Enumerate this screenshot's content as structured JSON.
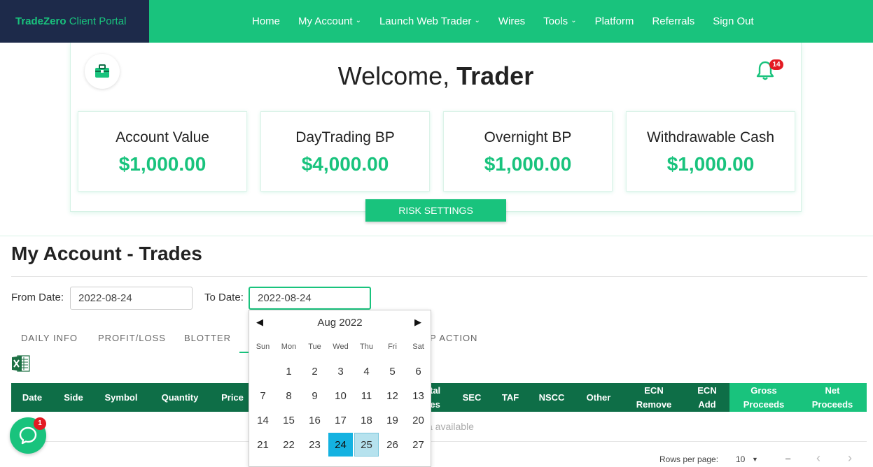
{
  "brand": {
    "bold": "TradeZero",
    "rest": " Client Portal"
  },
  "nav": {
    "items": [
      {
        "label": "Home",
        "dropdown": false
      },
      {
        "label": "My Account",
        "dropdown": true
      },
      {
        "label": "Launch Web Trader",
        "dropdown": true
      },
      {
        "label": "Wires",
        "dropdown": false
      },
      {
        "label": "Tools",
        "dropdown": true
      },
      {
        "label": "Platform",
        "dropdown": false
      },
      {
        "label": "Referrals",
        "dropdown": false
      },
      {
        "label": "Sign Out",
        "dropdown": false
      }
    ]
  },
  "welcome": {
    "prefix": "Welcome, ",
    "name": "Trader"
  },
  "notifications": {
    "count": "14"
  },
  "stats": [
    {
      "label": "Account Value",
      "value": "$1,000.00"
    },
    {
      "label": "DayTrading BP",
      "value": "$4,000.00"
    },
    {
      "label": "Overnight BP",
      "value": "$1,000.00"
    },
    {
      "label": "Withdrawable Cash",
      "value": "$1,000.00"
    }
  ],
  "risk_button": "RISK SETTINGS",
  "page_title": "My Account - Trades",
  "filters": {
    "from_label": "From Date:",
    "from_value": "2022-08-24",
    "to_label": "To Date:",
    "to_value": "2022-08-24"
  },
  "tabs": [
    {
      "label": "DAILY INFO"
    },
    {
      "label": "PROFIT/LOSS"
    },
    {
      "label": "BLOTTER"
    },
    {
      "label": "P ACTION"
    }
  ],
  "table": {
    "columns": [
      {
        "label": "Date"
      },
      {
        "label": "Side"
      },
      {
        "label": "Symbol"
      },
      {
        "label": "Quantity"
      },
      {
        "label": "Price"
      },
      {
        "label": "tal\nes"
      },
      {
        "label": "SEC"
      },
      {
        "label": "TAF"
      },
      {
        "label": "NSCC"
      },
      {
        "label": "Other"
      },
      {
        "label": "ECN\nRemove"
      },
      {
        "label": "ECN\nAdd"
      },
      {
        "label": "Gross\nProceeds"
      },
      {
        "label": "Net\nProceeds"
      }
    ],
    "empty_text": "a available"
  },
  "pagination": {
    "rows_label": "Rows per page:",
    "rows_value": "10",
    "range": "–",
    "prev": "‹",
    "next": "›"
  },
  "calendar": {
    "month": "Aug 2022",
    "prev": "◀",
    "next": "▶",
    "weekdays": [
      "Sun",
      "Mon",
      "Tue",
      "Wed",
      "Thu",
      "Fri",
      "Sat"
    ],
    "weeks": [
      [
        "",
        "1",
        "2",
        "3",
        "4",
        "5",
        "6"
      ],
      [
        "7",
        "8",
        "9",
        "10",
        "11",
        "12",
        "13"
      ],
      [
        "14",
        "15",
        "16",
        "17",
        "18",
        "19",
        "20"
      ],
      [
        "21",
        "22",
        "23",
        "24",
        "25",
        "26",
        "27"
      ]
    ],
    "selected": "24",
    "hovered": "25"
  },
  "chat": {
    "badge": "1"
  },
  "colors": {
    "brand_green": "#19c37d",
    "brand_navy": "#1d2a4a",
    "table_header": "#0e6e47",
    "selected_day": "#14b2e1",
    "badge_red": "#e31b23"
  }
}
